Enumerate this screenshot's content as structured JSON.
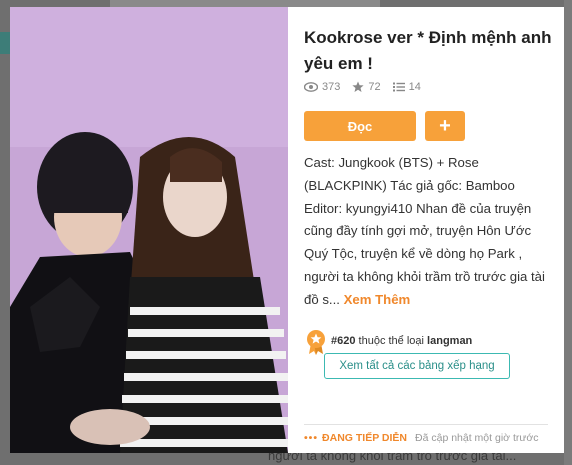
{
  "background": {
    "behind_text": "người ta không khỏi trầm trồ trước gia tài..."
  },
  "story": {
    "title": "Kookrose ver * Định mệnh anh yêu em !",
    "cover_alt": "Jungkook and Rose cover image",
    "stats": {
      "reads": "373",
      "votes": "72",
      "parts": "14"
    },
    "read_label": "Đọc",
    "add_label": "+",
    "description": "Cast: Jungkook (BTS) + Rose (BLACKPINK) Tác giả gốc: Bamboo Editor: kyungyi410 Nhan đề của truyện cũng đầy tính gợi mở, truyện Hôn Ước Quý Tộc, truyện kể về dòng họ Park , người ta không khỏi trầm trồ trước gia tài đồ s...",
    "more_label": "Xem Thêm"
  },
  "ranking": {
    "rank": "#620",
    "text_mid": " thuộc thể loại ",
    "genre": "langman",
    "all_label": "Xem tất cả các bảng xếp hạng"
  },
  "status": {
    "dots": "•••",
    "label": "ĐANG TIẾP DIỄN",
    "updated": "Đã cập nhật một giờ trước"
  },
  "colors": {
    "accent": "#f7a13a",
    "teal": "#3cb9b2",
    "cover_bg": "#c8a8d6"
  },
  "icons": {
    "reads": "eye-icon",
    "votes": "star-icon",
    "parts": "list-icon",
    "rank": "ribbon-badge-icon"
  }
}
